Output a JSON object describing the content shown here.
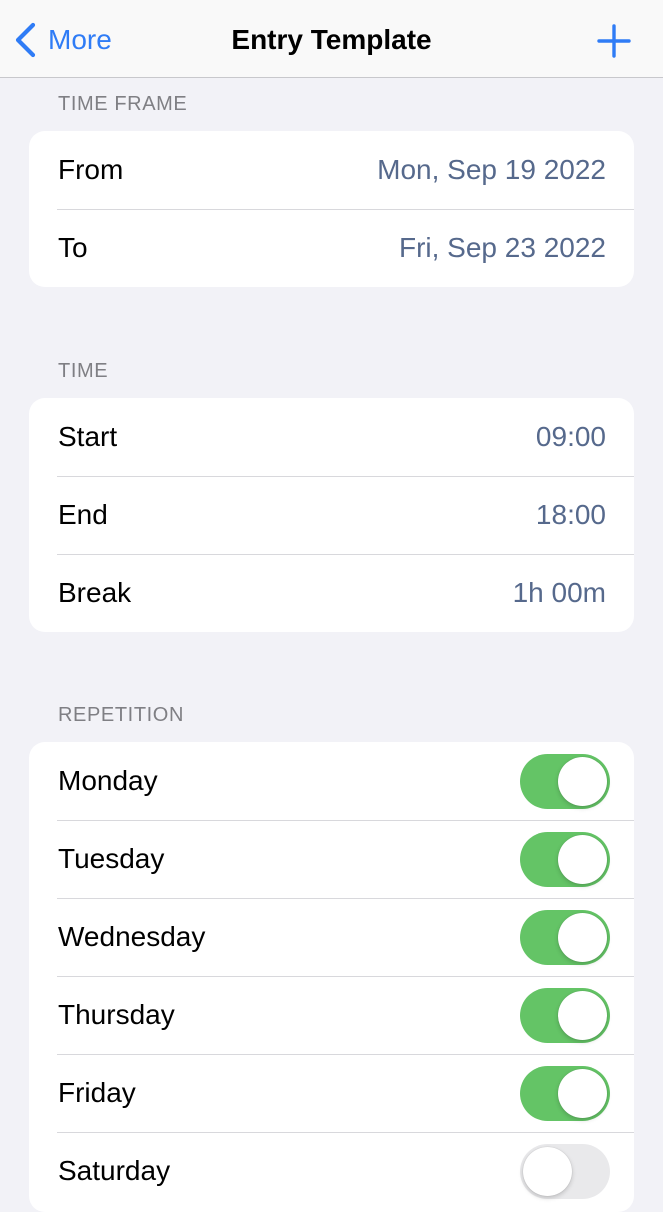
{
  "nav": {
    "back_label": "More",
    "title": "Entry Template",
    "accent_color": "#2f7cf6"
  },
  "time_frame": {
    "header": "TIME FRAME",
    "rows": [
      {
        "label": "From",
        "value": "Mon, Sep 19 2022"
      },
      {
        "label": "To",
        "value": "Fri, Sep 23 2022"
      }
    ]
  },
  "time": {
    "header": "TIME",
    "rows": [
      {
        "label": "Start",
        "value": "09:00"
      },
      {
        "label": "End",
        "value": "18:00"
      },
      {
        "label": "Break",
        "value": "1h 00m"
      }
    ]
  },
  "repetition": {
    "header": "REPETITION",
    "toggle_on_color": "#64c466",
    "days": [
      {
        "label": "Monday",
        "on": true
      },
      {
        "label": "Tuesday",
        "on": true
      },
      {
        "label": "Wednesday",
        "on": true
      },
      {
        "label": "Thursday",
        "on": true
      },
      {
        "label": "Friday",
        "on": true
      },
      {
        "label": "Saturday",
        "on": false
      }
    ]
  }
}
